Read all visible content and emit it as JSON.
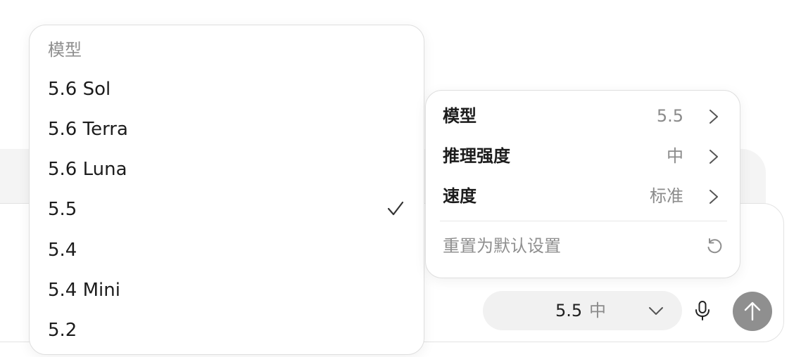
{
  "model_menu": {
    "heading": "模型",
    "options": [
      {
        "label": "5.6 Sol",
        "selected": false
      },
      {
        "label": "5.6 Terra",
        "selected": false
      },
      {
        "label": "5.6 Luna",
        "selected": false
      },
      {
        "label": "5.5",
        "selected": true
      },
      {
        "label": "5.4",
        "selected": false
      },
      {
        "label": "5.4 Mini",
        "selected": false
      },
      {
        "label": "5.2",
        "selected": false
      }
    ]
  },
  "settings_menu": {
    "rows": [
      {
        "label": "模型",
        "value": "5.5"
      },
      {
        "label": "推理强度",
        "value": "中"
      },
      {
        "label": "速度",
        "value": "标准"
      }
    ],
    "reset_label": "重置为默认设置"
  },
  "composer": {
    "model_pill": {
      "model": "5.5",
      "effort": "中"
    },
    "icons": {
      "chevron": "chevron-down-icon",
      "mic": "microphone-icon",
      "send": "arrow-up-icon",
      "check": "checkmark-icon",
      "reset": "reset-icon"
    }
  },
  "colors": {
    "send_button": "#8f8f8f",
    "pill_background": "#f1f1f1",
    "muted_text": "#8b8b8b"
  }
}
